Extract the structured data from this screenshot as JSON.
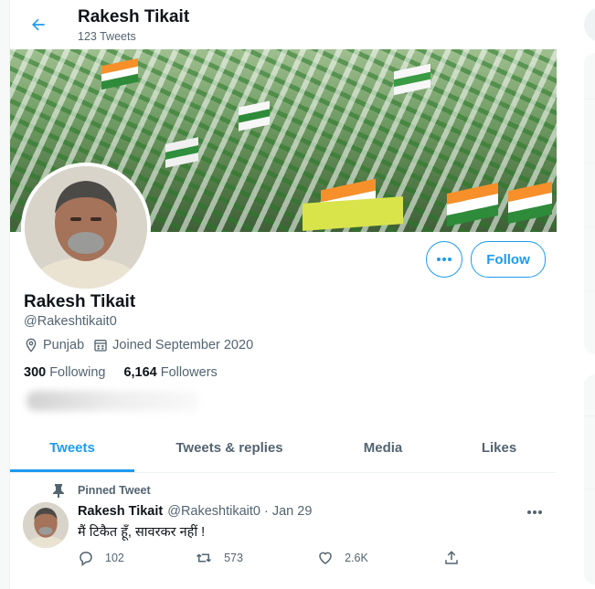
{
  "header": {
    "title": "Rakesh Tikait",
    "tweet_count": "123 Tweets"
  },
  "profile": {
    "display_name": "Rakesh Tikait",
    "handle": "@Rakeshtikait0",
    "location": "Punjab",
    "joined": "Joined September 2020",
    "following_count": "300",
    "following_label": "Following",
    "followers_count": "6,164",
    "followers_label": "Followers",
    "follow_button": "Follow"
  },
  "tabs": [
    {
      "label": "Tweets",
      "active": true
    },
    {
      "label": "Tweets & replies",
      "active": false
    },
    {
      "label": "Media",
      "active": false
    },
    {
      "label": "Likes",
      "active": false
    }
  ],
  "pinned_tweet": {
    "pinned_label": "Pinned Tweet",
    "author_name": "Rakesh Tikait",
    "author_handle": "@Rakeshtikait0",
    "separator": "·",
    "date": "Jan 29",
    "text": "मैं टिकैत हूँ, सावरकर नहीं !",
    "replies": "102",
    "retweets": "573",
    "likes": "2.6K"
  },
  "colors": {
    "accent": "#1d9bf0",
    "secondary_text": "#536471",
    "primary_text": "#0f1419"
  },
  "icons": [
    "back-arrow-icon",
    "location-icon",
    "calendar-icon",
    "more-icon",
    "pin-icon",
    "reply-icon",
    "retweet-icon",
    "like-icon",
    "share-icon"
  ]
}
